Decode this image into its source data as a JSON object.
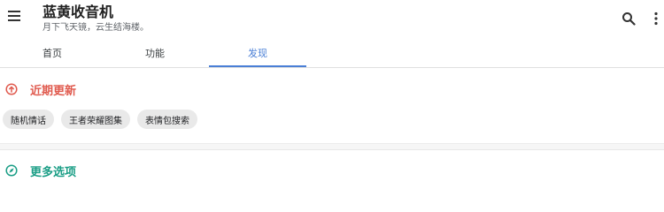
{
  "app": {
    "title": "蓝黄收音机",
    "subtitle": "月下飞天镜，云生结海楼。"
  },
  "icons": {
    "menu": "menu-icon",
    "search": "search-icon",
    "more": "more-vert-icon",
    "recent": "arrow-up-circle-icon",
    "explore": "compass-icon"
  },
  "tabs": [
    {
      "label": "首页",
      "active": false
    },
    {
      "label": "功能",
      "active": false
    },
    {
      "label": "发现",
      "active": true
    }
  ],
  "sections": {
    "recent": {
      "title": "近期更新",
      "color": "#e05a4e",
      "chips": [
        "随机情话",
        "王者荣耀图集",
        "表情包搜索"
      ]
    },
    "more": {
      "title": "更多选项",
      "color": "#1b9e86"
    }
  },
  "colors": {
    "accent": "#4a7fd6",
    "chip_bg": "#e9e9e9"
  }
}
